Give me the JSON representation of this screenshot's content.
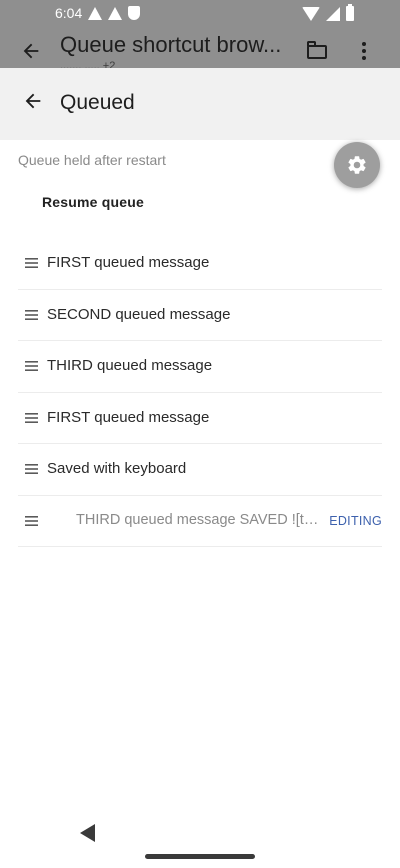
{
  "status_bar": {
    "time": "6:04",
    "icons": [
      "warning-icon",
      "warning-icon",
      "shield-icon",
      "wifi-icon",
      "signal-icon",
      "battery-icon"
    ]
  },
  "app_bar": {
    "title": "Queue shortcut brow...",
    "subtitle": "....... ..... +2",
    "icons": [
      "back-arrow-icon",
      "folder-icon",
      "more-vert-icon"
    ]
  },
  "sheet": {
    "title": "Queued",
    "hint": "Queue held after restart",
    "resume_label": "Resume queue",
    "items": [
      {
        "label": "FIRST queued message"
      },
      {
        "label": "SECOND queued message"
      },
      {
        "label": "THIRD queued message"
      },
      {
        "label": "FIRST queued message"
      },
      {
        "label": "Saved with keyboard"
      },
      {
        "label": "THIRD queued message SAVED ![te…",
        "tag": "EDITING"
      }
    ]
  },
  "colors": {
    "scrim": "#8f8f8f",
    "sheet_header": "#f1f1f1",
    "editing_tag": "#3d61ad",
    "hint_text": "#8a8a8a"
  }
}
